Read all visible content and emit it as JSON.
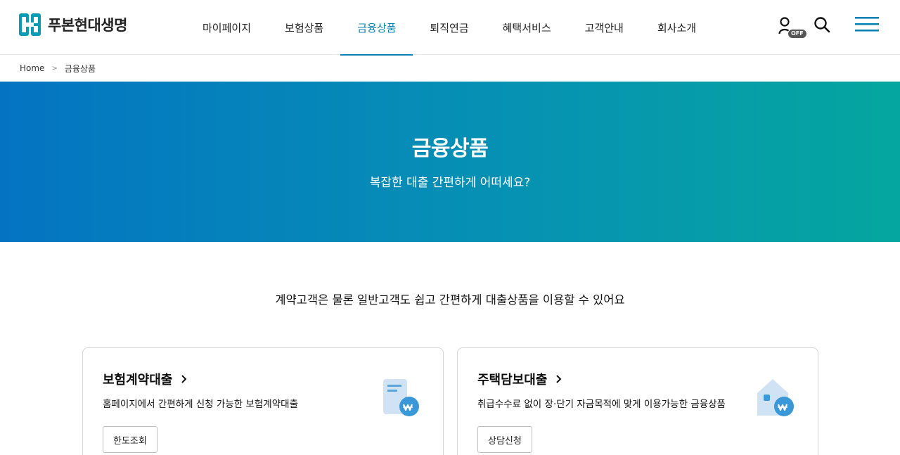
{
  "brand": {
    "name": "푸본현대생명"
  },
  "nav": {
    "items": [
      {
        "label": "마이페이지"
      },
      {
        "label": "보험상품"
      },
      {
        "label": "금융상품"
      },
      {
        "label": "퇴직연금"
      },
      {
        "label": "혜택서비스"
      },
      {
        "label": "고객안내"
      },
      {
        "label": "회사소개"
      }
    ],
    "active": "금융상품",
    "accent_color": "#0a82b4"
  },
  "utility": {
    "user_badge": "OFF",
    "icons": [
      "user-icon",
      "search-icon",
      "hamburger-menu-icon"
    ]
  },
  "breadcrumb": {
    "home": "Home",
    "current": "금융상품"
  },
  "hero": {
    "title": "금융상품",
    "subtitle": "복잡한 대출 간편하게 어떠세요?",
    "gradient": [
      "#0474c2",
      "#05a69f"
    ]
  },
  "intro": "계약고객은 물론 일반고객도 쉽고 간편하게 대출상품을 이용할 수 있어요",
  "cards": [
    {
      "title": "보험계약대출",
      "desc": "홈페이지에서 간편하게 신청 가능한 보험계약대출",
      "button": "한도조회",
      "icon": "document-won-icon"
    },
    {
      "title": "주택담보대출",
      "desc": "취급수수료 없이 장·단기 자금목적에 맞게 이용가능한 금융상품",
      "button": "상담신청",
      "icon": "house-won-icon"
    }
  ]
}
